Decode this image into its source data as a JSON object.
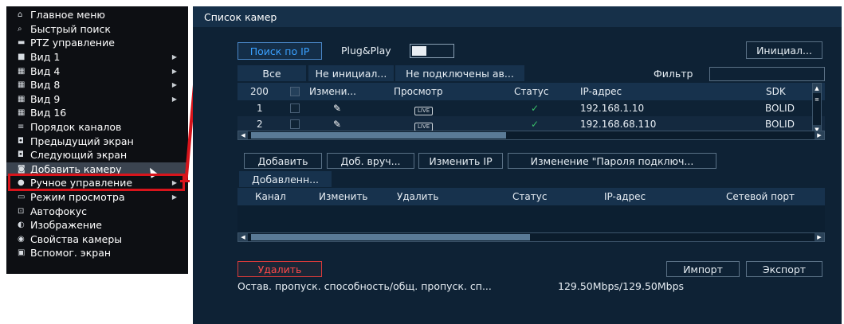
{
  "menu": {
    "items": [
      {
        "icon": "home-icon",
        "glyph": "⌂",
        "label": "Главное меню",
        "submenu": false
      },
      {
        "icon": "search-icon",
        "glyph": "⌕",
        "label": "Быстрый поиск",
        "submenu": false
      },
      {
        "icon": "ptz-icon",
        "glyph": "▬",
        "label": "PTZ управление",
        "submenu": false
      },
      {
        "icon": "view1-icon",
        "glyph": "■",
        "label": "Вид 1",
        "submenu": true
      },
      {
        "icon": "view4-icon",
        "glyph": "▦",
        "label": "Вид 4",
        "submenu": true
      },
      {
        "icon": "view8-icon",
        "glyph": "▦",
        "label": "Вид 8",
        "submenu": true
      },
      {
        "icon": "view9-icon",
        "glyph": "▦",
        "label": "Вид 9",
        "submenu": true
      },
      {
        "icon": "view16-icon",
        "glyph": "▦",
        "label": "Вид 16",
        "submenu": false
      },
      {
        "icon": "channel-order-icon",
        "glyph": "≡",
        "label": "Порядок каналов",
        "submenu": false
      },
      {
        "icon": "prev-screen-icon",
        "glyph": "◘",
        "label": "Предыдущий экран",
        "submenu": false
      },
      {
        "icon": "next-screen-icon",
        "glyph": "◘",
        "label": "Следующий экран",
        "submenu": false
      },
      {
        "icon": "add-camera-icon",
        "glyph": "◙",
        "label": "Добавить камеру",
        "submenu": false,
        "active": true
      },
      {
        "icon": "manual-control-icon",
        "glyph": "●",
        "label": "Ручное управление",
        "submenu": true
      },
      {
        "icon": "view-mode-icon",
        "glyph": "▭",
        "label": "Режим просмотра",
        "submenu": true
      },
      {
        "icon": "autofocus-icon",
        "glyph": "⊡",
        "label": "Автофокус",
        "submenu": false
      },
      {
        "icon": "image-icon",
        "glyph": "◐",
        "label": "Изображение",
        "submenu": false
      },
      {
        "icon": "camera-props-icon",
        "glyph": "◉",
        "label": "Свойства камеры",
        "submenu": false
      },
      {
        "icon": "aux-screen-icon",
        "glyph": "▣",
        "label": "Вспомог. экран",
        "submenu": false
      }
    ]
  },
  "dialog": {
    "title": "Список камер",
    "search_ip_label": "Поиск по IP",
    "plug_play_label": "Plug&Play",
    "init_label": "Инициал...",
    "filter_label": "Фильтр",
    "filter_tabs": [
      "Все",
      "Не инициал...",
      "Не подключены ав..."
    ],
    "devices_table": {
      "count": "200",
      "headers": [
        "Измени...",
        "Просмотр",
        "Статус",
        "IP-адрес",
        "SDK"
      ],
      "rows": [
        {
          "num": "1",
          "live": "LIVE",
          "ip": "192.168.1.10",
          "sdk": "BOLID"
        },
        {
          "num": "2",
          "live": "LIVE",
          "ip": "192.168.68.110",
          "sdk": "BOLID"
        }
      ]
    },
    "actions": [
      "Добавить",
      "Доб. вруч...",
      "Изменить IP",
      "Изменение \"Пароля подключ..."
    ],
    "added_label": "Добавленн...",
    "added_table": {
      "headers": [
        "Канал",
        "Изменить",
        "Удалить",
        "Статус",
        "IP-адрес",
        "Сетевой порт"
      ]
    },
    "delete_label": "Удалить",
    "import_label": "Импорт",
    "export_label": "Экспорт",
    "bandwidth_label": "Остав. пропуск. способность/общ. пропуск. сп...",
    "bandwidth_value": "129.50Mbps/129.50Mbps"
  },
  "colors": {
    "accent": "#3aa0ff",
    "highlight": "#d8141b",
    "status_ok": "#3ac06a",
    "danger": "#ff4a4a"
  }
}
